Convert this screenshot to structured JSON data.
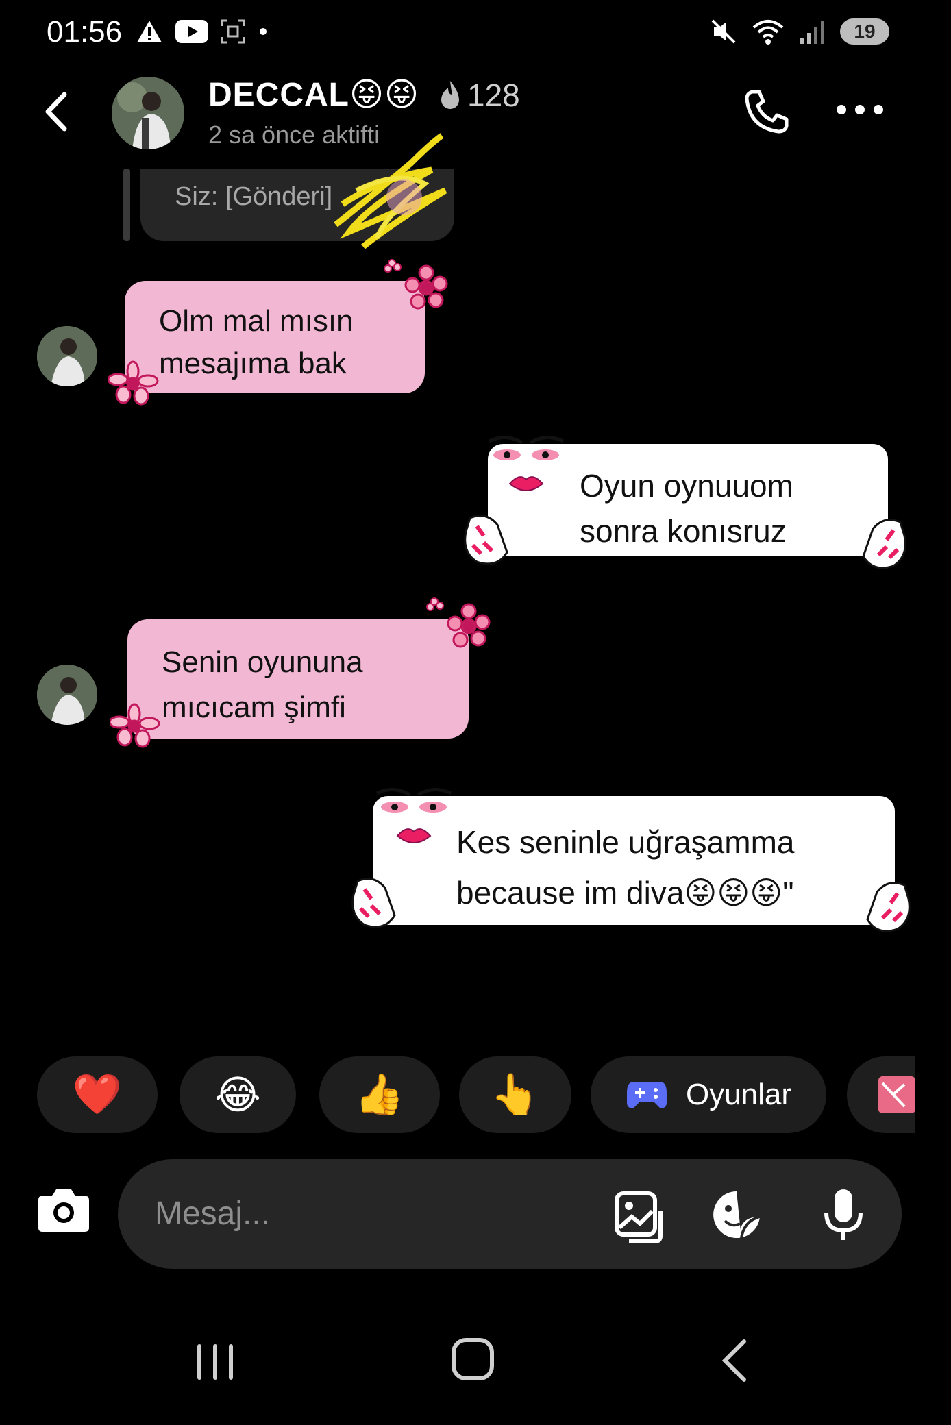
{
  "status_bar": {
    "time": "01:56",
    "battery": "19"
  },
  "header": {
    "name": "DECCAL😝😝",
    "streak_count": "128",
    "active_status": "2 sa önce aktifti"
  },
  "reply_preview": {
    "text": "Siz: [Gönderi]"
  },
  "messages": [
    {
      "side": "received",
      "lines": [
        "Olm mal mısın",
        "mesajıma bak"
      ]
    },
    {
      "side": "sent",
      "lines": [
        "Oyun oynuuom",
        "sonra konısruz"
      ]
    },
    {
      "side": "received",
      "lines": [
        "Senin oyununa",
        "mıcıcam şimfi"
      ]
    },
    {
      "side": "sent",
      "lines": [
        "Kes seninle uğraşamma",
        "because im diva😝😝😝\""
      ]
    }
  ],
  "quick_bar": {
    "items": [
      {
        "emoji": "❤️"
      },
      {
        "emoji": "😂"
      },
      {
        "emoji": "👍"
      },
      {
        "emoji": "👆"
      },
      {
        "label": "Oyunlar"
      }
    ]
  },
  "composer": {
    "placeholder": "Mesaj..."
  },
  "colors": {
    "background": "#000000",
    "received_bubble": "#f2b7d3",
    "sent_bubble": "#ffffff",
    "accent": "#d6336c",
    "game_icon": "#5b6cf7"
  },
  "icons": [
    "back-arrow-icon",
    "phone-icon",
    "more-icon",
    "camera-icon",
    "gallery-icon",
    "sticker-icon",
    "microphone-icon",
    "game-controller-icon"
  ]
}
